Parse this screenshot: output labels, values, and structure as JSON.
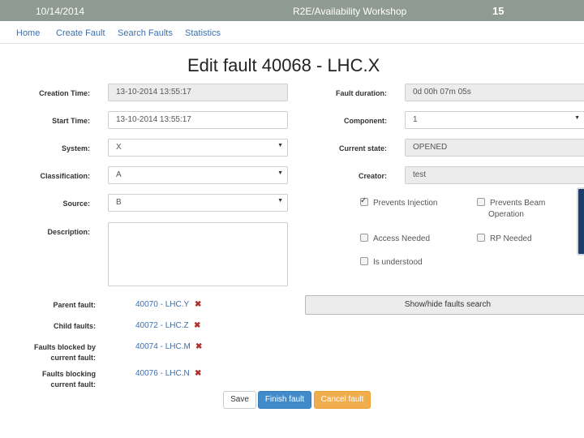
{
  "slide": {
    "date": "10/14/2014",
    "title": "R2E/Availability Workshop",
    "number": "15"
  },
  "nav": {
    "home": "Home",
    "create": "Create Fault",
    "search": "Search Faults",
    "statistics": "Statistics"
  },
  "page_title": "Edit fault 40068 - LHC.X",
  "left": {
    "creation_time": {
      "label": "Creation Time:",
      "value": "13-10-2014 13:55:17"
    },
    "start_time": {
      "label": "Start Time:",
      "value": "13-10-2014 13:55:17"
    },
    "system": {
      "label": "System:",
      "value": "X"
    },
    "classification": {
      "label": "Classification:",
      "value": "A"
    },
    "source": {
      "label": "Source:",
      "value": "B"
    },
    "description": {
      "label": "Description:",
      "value": ""
    }
  },
  "right": {
    "duration": {
      "label": "Fault duration:",
      "value": "0d 00h 07m 05s"
    },
    "component": {
      "label": "Component:",
      "value": "1"
    },
    "state": {
      "label": "Current state:",
      "value": "OPENED"
    },
    "creator": {
      "label": "Creator:",
      "value": "test"
    }
  },
  "checks": {
    "prevents_injection": {
      "label": "Prevents Injection",
      "checked": true
    },
    "prevents_beam_1": "Prevents Beam",
    "prevents_beam_2": "Operation",
    "access_needed": {
      "label": "Access Needed",
      "checked": false
    },
    "rp_needed": {
      "label": "RP Needed",
      "checked": false
    },
    "is_understood": {
      "label": "Is understood",
      "checked": false
    }
  },
  "relations": {
    "parent": {
      "label": "Parent fault:",
      "value": "40070 - LHC.Y"
    },
    "child": {
      "label": "Child faults:",
      "value": "40072 - LHC.Z"
    },
    "blocked_by_1": "Faults blocked by",
    "blocked_by_2": "current fault:",
    "blocked_by": {
      "value": "40074 - LHC.M"
    },
    "blocking_1": "Faults blocking",
    "blocking_2": "current fault:",
    "blocking": {
      "value": "40076 - LHC.N"
    },
    "remove_icon": "✖"
  },
  "show_hide": "Show/hide faults search",
  "buttons": {
    "save": "Save",
    "finish": "Finish fault",
    "cancel": "Cancel fault"
  },
  "colors": {
    "topbar": "#8f9a92",
    "link": "#3a70b0",
    "primary": "#428bca",
    "warning": "#f0ad4e"
  }
}
